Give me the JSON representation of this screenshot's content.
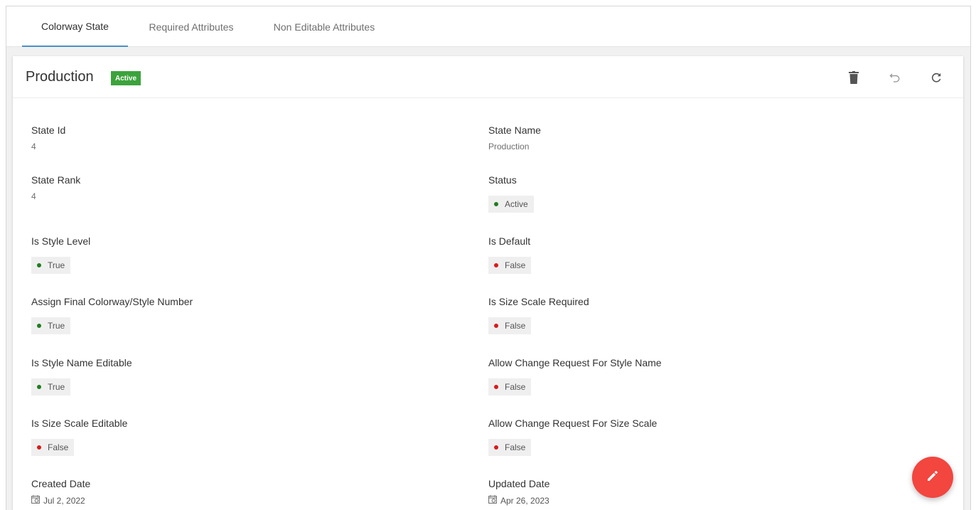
{
  "tabs": [
    {
      "label": "Colorway State"
    },
    {
      "label": "Required Attributes"
    },
    {
      "label": "Non Editable Attributes"
    }
  ],
  "header": {
    "title": "Production",
    "badge": "Active",
    "icons": [
      "trash-icon",
      "undo-icon",
      "refresh-icon"
    ]
  },
  "fields": {
    "state_id": {
      "label": "State Id",
      "value": "4"
    },
    "state_name": {
      "label": "State Name",
      "value": "Production"
    },
    "state_rank": {
      "label": "State Rank",
      "value": "4"
    },
    "status": {
      "label": "Status",
      "value": "Active"
    },
    "is_style_level": {
      "label": "Is Style Level",
      "value": "True"
    },
    "is_default": {
      "label": "Is Default",
      "value": "False"
    },
    "assign_final": {
      "label": "Assign Final Colorway/Style Number",
      "value": "True"
    },
    "size_scale_required": {
      "label": "Is Size Scale Required",
      "value": "False"
    },
    "style_name_editable": {
      "label": "Is Style Name Editable",
      "value": "True"
    },
    "cr_style_name": {
      "label": "Allow Change Request For Style Name",
      "value": "False"
    },
    "size_scale_editable": {
      "label": "Is Size Scale Editable",
      "value": "False"
    },
    "cr_size_scale": {
      "label": "Allow Change Request For Size Scale",
      "value": "False"
    },
    "created_date": {
      "label": "Created Date",
      "value": "Jul 2, 2022"
    },
    "updated_date": {
      "label": "Updated Date",
      "value": "Apr 26, 2023"
    }
  },
  "colors": {
    "active_tab_underline": "#4a90c7",
    "badge_green": "#3ca33c",
    "true_dot": "#1f7d1f",
    "false_dot": "#d81b1b",
    "fab": "#f2463f"
  }
}
